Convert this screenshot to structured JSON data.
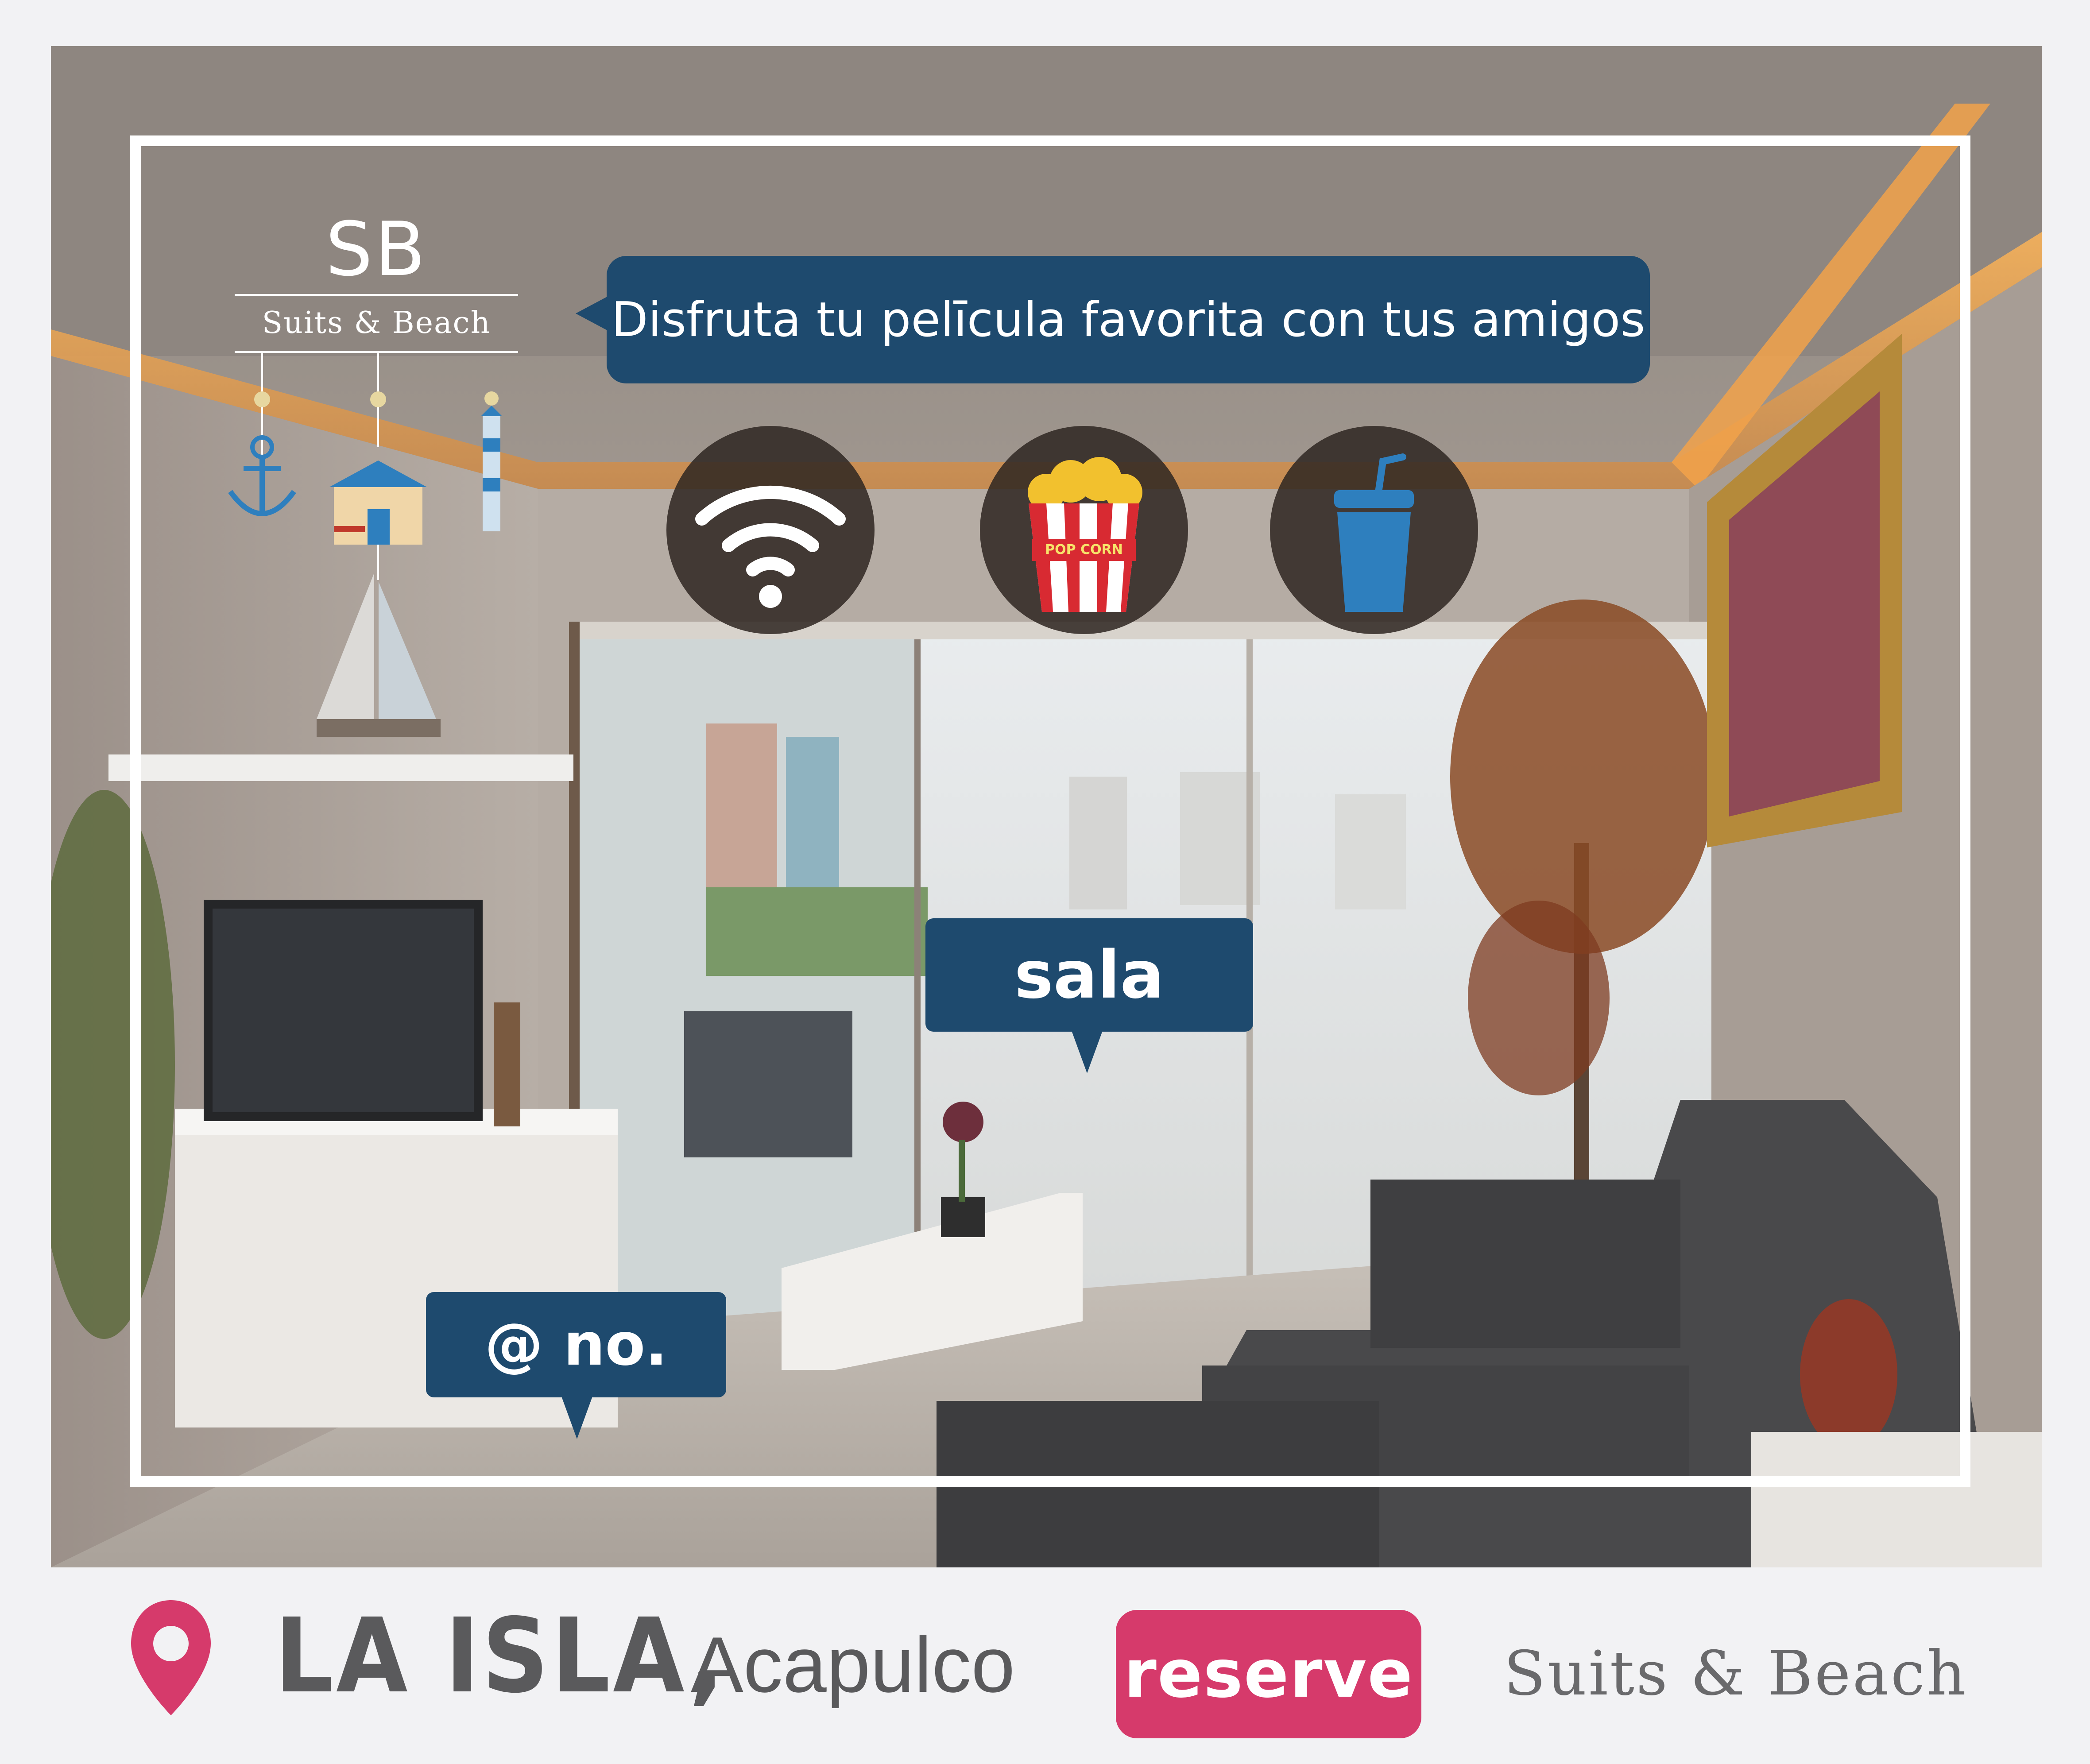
{
  "logo": {
    "initials": "SB",
    "name": "Suits & Beach"
  },
  "bubbles": {
    "top": "Disfruta tu pelīcula favorita con tus amigos",
    "room": "sala",
    "number": "@ no."
  },
  "amenities": {
    "popcorn_label": "POP CORN",
    "items": [
      {
        "icon": "wifi-icon"
      },
      {
        "icon": "popcorn-icon"
      },
      {
        "icon": "drink-cup-icon"
      }
    ]
  },
  "footer": {
    "location": "LA ISLA,",
    "city": "Acapulco",
    "reserve_label": "reserve",
    "brand": "Suits & Beach"
  },
  "colors": {
    "bubble": "#1e4a6e",
    "accent_pink": "#d63a6b",
    "footer_text": "#5a5a5c",
    "icon_blue": "#2e7fbe"
  }
}
